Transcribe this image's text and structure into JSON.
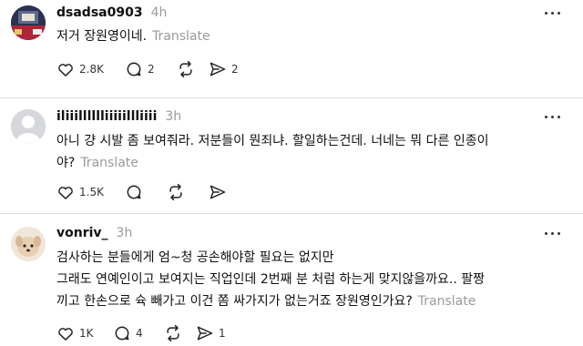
{
  "posts": [
    {
      "username": "dsadsa0903",
      "time": "4h",
      "lines": [
        "저거 장원영이네."
      ],
      "translate": "Translate",
      "likes": "2.8K",
      "comments": "2",
      "reposts": "",
      "shares": "2"
    },
    {
      "username": "iliiilllllliiiiillliiii",
      "time": "3h",
      "lines": [
        "아니 걍 시발 좀 보여줘라. 저분들이 뭔죄냐. 할일하는건데. 너네는 뭐 다른 인종이",
        "야?"
      ],
      "translate": "Translate",
      "likes": "1.5K",
      "comments": "",
      "reposts": "",
      "shares": ""
    },
    {
      "username": "vonriv_",
      "time": "3h",
      "lines": [
        "검사하는 분들에게 엄~청 공손해야할 필요는 없지만",
        "그래도 연예인이고 보여지는 직업인데 2번째 분 처럼 하는게 맞지않을까요.. 팔짱",
        "끼고 한손으로 슉 빼가고 이건 쫌 싸가지가 없는거죠 장원영인가요?"
      ],
      "translate": "Translate",
      "likes": "1K",
      "comments": "4",
      "reposts": "",
      "shares": "1"
    }
  ],
  "icons": {
    "like": "heart-icon",
    "comment": "comment-bubble-icon",
    "repost": "repost-icon",
    "share": "share-send-icon",
    "more": "more-options-icon"
  }
}
